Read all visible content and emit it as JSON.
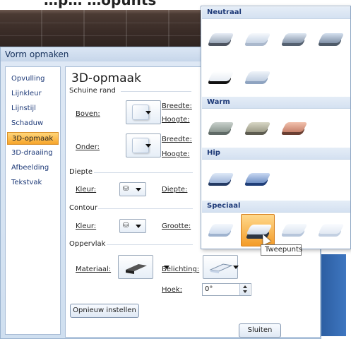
{
  "background": {
    "top_heading": "…p… …opunts"
  },
  "dialog": {
    "title": "Vorm opmaken",
    "nav": [
      "Opvulling",
      "Lijnkleur",
      "Lijnstijl",
      "Schaduw",
      "3D-opmaak",
      "3D-draaiing",
      "Afbeelding",
      "Tekstvak"
    ],
    "active_nav": "3D-opmaak",
    "panel": {
      "title": "3D-opmaak",
      "bevel": {
        "section": "Schuine rand",
        "top": "Boven:",
        "bottom": "Onder:",
        "width1": "Breedte:",
        "height1": "Hoogte:",
        "width2": "Breedte:",
        "height2": "Hoogte:"
      },
      "depth": {
        "section": "Diepte",
        "color": "Kleur:",
        "depth": "Diepte:"
      },
      "contour": {
        "section": "Contour",
        "color": "Kleur:",
        "size": "Grootte:"
      },
      "surface": {
        "section": "Oppervlak",
        "material": "Materiaal:",
        "lighting": "Belichting:",
        "angle": "Hoek:",
        "angle_value": "0°"
      },
      "reset_button": "Opnieuw instellen"
    },
    "close_button": "Sluiten"
  },
  "gallery": {
    "sections": [
      "Neutraal",
      "Warm",
      "Hip",
      "Speciaal"
    ],
    "hovered": "Tweepunts",
    "tooltip": "Tweepunts"
  },
  "colors": {
    "accent_orange": "#f7a52b",
    "nav_text": "#1e3a78",
    "dialog_bg": "#dfe9f5"
  }
}
